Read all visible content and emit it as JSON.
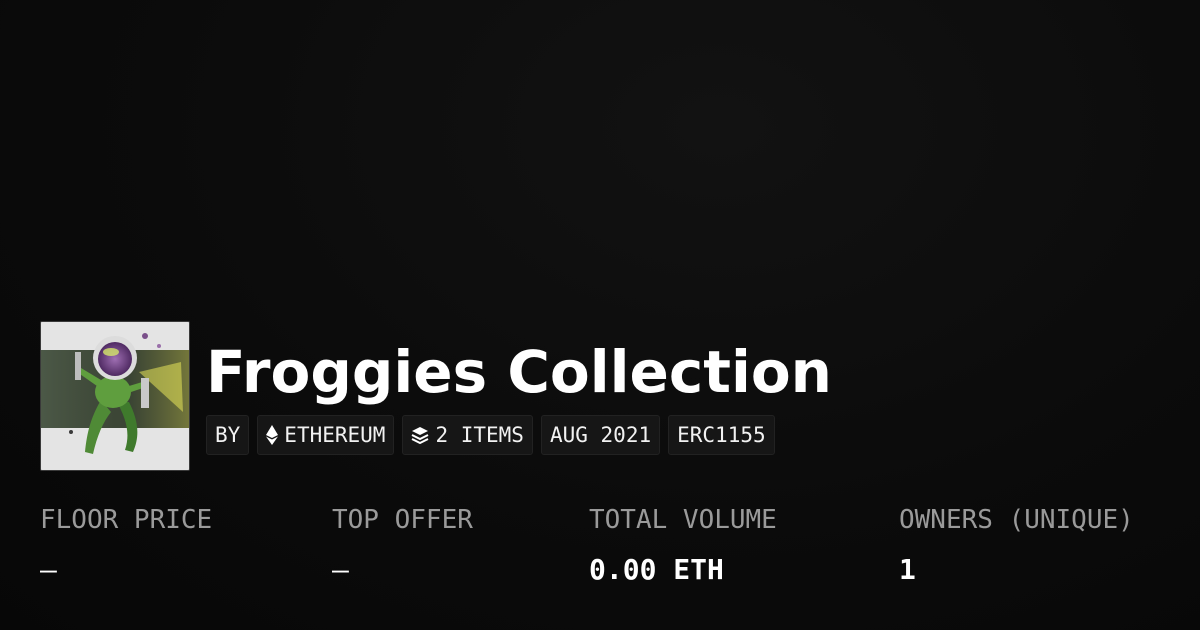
{
  "collection": {
    "title": "Froggies Collection",
    "image_icon": "frog-astronaut-thumbnail"
  },
  "chips": [
    {
      "label": "BY",
      "icon": ""
    },
    {
      "label": "ETHEREUM",
      "icon": "ethereum-icon"
    },
    {
      "label": "2 ITEMS",
      "icon": "layers-icon"
    },
    {
      "label": "AUG 2021",
      "icon": ""
    },
    {
      "label": "ERC1155",
      "icon": ""
    }
  ],
  "stats": [
    {
      "label": "FLOOR PRICE",
      "value": "—"
    },
    {
      "label": "TOP OFFER",
      "value": "—"
    },
    {
      "label": "TOTAL VOLUME",
      "value": "0.00 ETH"
    },
    {
      "label": "OWNERS (UNIQUE)",
      "value": "1"
    }
  ],
  "colors": {
    "background": "#0b0b0b",
    "chip_background": "#161616",
    "label_gray": "#9a9a9a",
    "text": "#ffffff"
  }
}
